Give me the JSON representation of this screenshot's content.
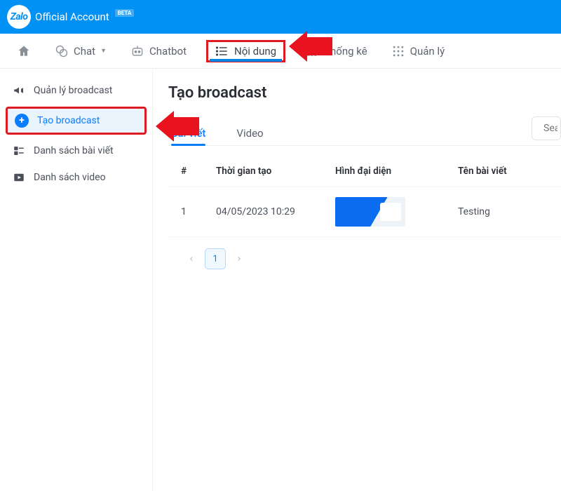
{
  "header": {
    "logo_text": "Zalo",
    "brand": "Official Account",
    "beta": "BETA"
  },
  "navbar": {
    "chat": "Chat",
    "chatbot": "Chatbot",
    "noi_dung": "Nội dung",
    "thong_ke": "Thống kê",
    "quan_ly": "Quản lý"
  },
  "sidebar": {
    "items": [
      {
        "label": "Quản lý broadcast"
      },
      {
        "label": "Tạo broadcast"
      },
      {
        "label": "Danh sách bài viết"
      },
      {
        "label": "Danh sách video"
      }
    ]
  },
  "page": {
    "title": "Tạo broadcast",
    "tabs": {
      "bai_viet": "Bài viết",
      "video": "Video"
    },
    "search_placeholder": "Sea"
  },
  "table": {
    "cols": {
      "idx": "#",
      "time": "Thời gian tạo",
      "thumb": "Hình đại diện",
      "name": "Tên bài viết"
    },
    "rows": [
      {
        "idx": "1",
        "time": "04/05/2023 10:29",
        "name": "Testing"
      }
    ]
  },
  "pagination": {
    "current": "1"
  }
}
